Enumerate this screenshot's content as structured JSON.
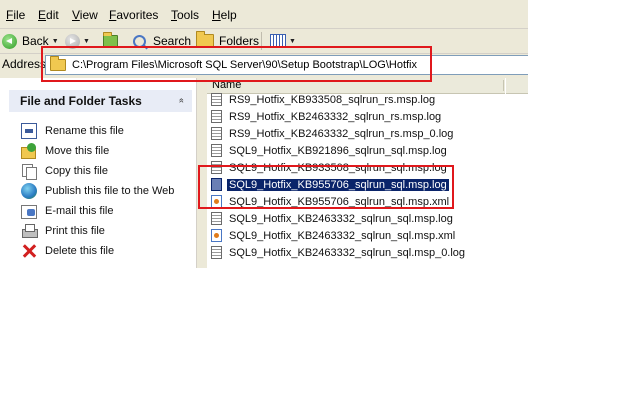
{
  "menu": [
    "File",
    "Edit",
    "View",
    "Favorites",
    "Tools",
    "Help"
  ],
  "toolbar": {
    "back_label": "Back",
    "search_label": "Search",
    "folders_label": "Folders"
  },
  "address": {
    "label": "Address",
    "path": "C:\\Program Files\\Microsoft SQL Server\\90\\Setup Bootstrap\\LOG\\Hotfix"
  },
  "tasks": {
    "title": "File and Folder Tasks",
    "collapse_glyph": "«",
    "items": [
      {
        "label": "Rename this file",
        "icon": "rename-icon"
      },
      {
        "label": "Move this file",
        "icon": "move-icon"
      },
      {
        "label": "Copy this file",
        "icon": "copy-icon"
      },
      {
        "label": "Publish this file to the Web",
        "icon": "publish-web-icon"
      },
      {
        "label": "E-mail this file",
        "icon": "email-icon"
      },
      {
        "label": "Print this file",
        "icon": "print-icon"
      },
      {
        "label": "Delete this file",
        "icon": "delete-icon"
      }
    ]
  },
  "filelist": {
    "column_name": "Name",
    "files": [
      {
        "name": "RS9_Hotfix_KB933508_sqlrun_rs.msp.log",
        "type": "log",
        "selected": false
      },
      {
        "name": "RS9_Hotfix_KB2463332_sqlrun_rs.msp.log",
        "type": "log",
        "selected": false
      },
      {
        "name": "RS9_Hotfix_KB2463332_sqlrun_rs.msp_0.log",
        "type": "log",
        "selected": false
      },
      {
        "name": "SQL9_Hotfix_KB921896_sqlrun_sql.msp.log",
        "type": "log",
        "selected": false
      },
      {
        "name": "SQL9_Hotfix_KB933508_sqlrun_sql.msp.log",
        "type": "log",
        "selected": false
      },
      {
        "name": "SQL9_Hotfix_KB955706_sqlrun_sql.msp.log",
        "type": "log",
        "selected": true
      },
      {
        "name": "SQL9_Hotfix_KB955706_sqlrun_sql.msp.xml",
        "type": "xml",
        "selected": false
      },
      {
        "name": "SQL9_Hotfix_KB2463332_sqlrun_sql.msp.log",
        "type": "log",
        "selected": false
      },
      {
        "name": "SQL9_Hotfix_KB2463332_sqlrun_sql.msp.xml",
        "type": "xml",
        "selected": false
      },
      {
        "name": "SQL9_Hotfix_KB2463332_sqlrun_sql.msp_0.log",
        "type": "log",
        "selected": false
      }
    ]
  },
  "colors": {
    "highlight_box": "#e0181c",
    "selection": "#0a246a",
    "chrome": "#ece9d8"
  }
}
